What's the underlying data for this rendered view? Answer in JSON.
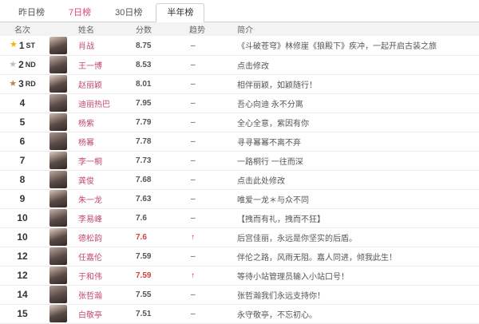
{
  "tabs": [
    {
      "label": "昨日榜"
    },
    {
      "label": "7日榜"
    },
    {
      "label": "30日榜"
    },
    {
      "label": "半年榜"
    }
  ],
  "columns": {
    "rank": "名次",
    "name": "姓名",
    "score": "分数",
    "trend": "趋势",
    "desc": "简介"
  },
  "colors": {
    "accent": "#e0457b",
    "name": "#c04a6e",
    "score_red": "#d04040",
    "gold_star": "#f2b400",
    "silver_star": "#bdbdbd",
    "bronze_star": "#b0894a"
  },
  "rows": [
    {
      "rank": "1",
      "rank_suffix": "ST",
      "medal": "gold",
      "name": "肖战",
      "score": "8.75",
      "trend": "–",
      "desc": "《斗破苍穹》林修崖《狼殿下》疾冲，一起开启古装之旅"
    },
    {
      "rank": "2",
      "rank_suffix": "ND",
      "medal": "silver",
      "name": "王一博",
      "score": "8.53",
      "trend": "–",
      "desc": "点击修改"
    },
    {
      "rank": "3",
      "rank_suffix": "RD",
      "medal": "bronze",
      "name": "赵丽颖",
      "score": "8.01",
      "trend": "–",
      "desc": "相伴丽颖，如颖随行！"
    },
    {
      "rank": "4",
      "rank_suffix": "",
      "medal": "",
      "name": "迪丽热巴",
      "score": "7.95",
      "trend": "–",
      "desc": "吾心向迪 永不分离"
    },
    {
      "rank": "5",
      "rank_suffix": "",
      "medal": "",
      "name": "杨紫",
      "score": "7.79",
      "trend": "–",
      "desc": "全心全意，紫因有你"
    },
    {
      "rank": "6",
      "rank_suffix": "",
      "medal": "",
      "name": "杨幂",
      "score": "7.78",
      "trend": "–",
      "desc": "寻寻幂幂不离不弃"
    },
    {
      "rank": "7",
      "rank_suffix": "",
      "medal": "",
      "name": "李一桐",
      "score": "7.73",
      "trend": "–",
      "desc": "一路桐行 一往而深"
    },
    {
      "rank": "8",
      "rank_suffix": "",
      "medal": "",
      "name": "龚俊",
      "score": "7.68",
      "trend": "–",
      "desc": "点击此处修改"
    },
    {
      "rank": "9",
      "rank_suffix": "",
      "medal": "",
      "name": "朱一龙",
      "score": "7.63",
      "trend": "–",
      "desc": "唯爱一龙＊与众不同"
    },
    {
      "rank": "10",
      "rank_suffix": "",
      "medal": "",
      "name": "李易峰",
      "score": "7.6",
      "trend": "–",
      "desc": "【拽而有礼，拽而不狂】"
    },
    {
      "rank": "10",
      "rank_suffix": "",
      "medal": "",
      "name": "德松韵",
      "score": "7.6",
      "trend": "↑",
      "desc": "后宫佳丽，永远是你坚实的后盾。",
      "score_red": true
    },
    {
      "rank": "12",
      "rank_suffix": "",
      "medal": "",
      "name": "任嘉伦",
      "score": "7.59",
      "trend": "–",
      "desc": "伴伦之路，风雨无阻。嘉人同进，倾我此生！"
    },
    {
      "rank": "12",
      "rank_suffix": "",
      "medal": "",
      "name": "于和伟",
      "score": "7.59",
      "trend": "↑",
      "desc": "等待小站管理员输入小站口号！",
      "score_red": true
    },
    {
      "rank": "14",
      "rank_suffix": "",
      "medal": "",
      "name": "张哲瀚",
      "score": "7.55",
      "trend": "–",
      "desc": "张哲瀚我们永远支持你！"
    },
    {
      "rank": "15",
      "rank_suffix": "",
      "medal": "",
      "name": "白敬亭",
      "score": "7.51",
      "trend": "–",
      "desc": "永守敬亭，不忘初心。"
    }
  ]
}
